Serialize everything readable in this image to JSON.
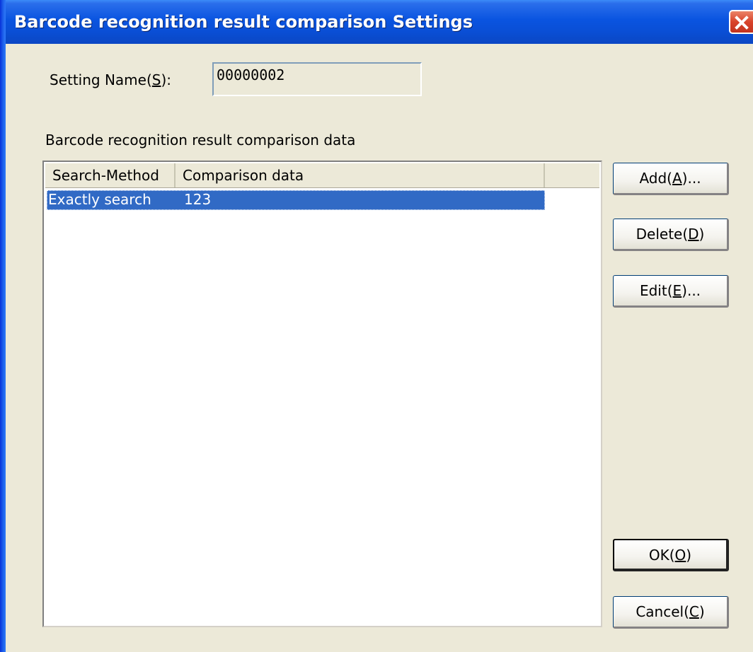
{
  "window": {
    "title": "Barcode recognition result comparison Settings"
  },
  "setting_name": {
    "label_prefix": "Setting Name(",
    "label_key": "S",
    "label_suffix": "):",
    "value": "00000002"
  },
  "comparison": {
    "group_label": "Barcode recognition result comparison data",
    "columns": [
      "Search-Method",
      "Comparison data"
    ],
    "rows": [
      {
        "method": "Exactly search",
        "data": "123"
      }
    ]
  },
  "buttons": {
    "add": {
      "prefix": "Add(",
      "key": "A",
      "suffix": ")..."
    },
    "delete": {
      "prefix": "Delete(",
      "key": "D",
      "suffix": ")"
    },
    "edit": {
      "prefix": "Edit(",
      "key": "E",
      "suffix": ")..."
    },
    "ok": {
      "prefix": "OK(",
      "key": "O",
      "suffix": ")"
    },
    "cancel": {
      "prefix": "Cancel(",
      "key": "C",
      "suffix": ")"
    }
  },
  "colors": {
    "titlebar": "#0A54E0",
    "selection": "#316AC5",
    "dialog_bg": "#ECE9D8",
    "close_button": "#D8432B"
  },
  "icons": {
    "close": "close-icon"
  }
}
